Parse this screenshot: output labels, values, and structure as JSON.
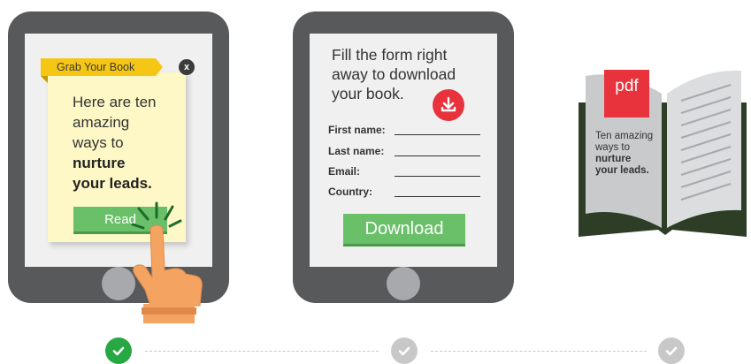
{
  "popup": {
    "banner": "Grab Your Book",
    "close": "x",
    "line1": "Here are ten",
    "line2": "amazing",
    "line3": "ways to",
    "line4": "nurture",
    "line5": "your leads.",
    "button": "Read"
  },
  "form": {
    "title1": "Fill the form right",
    "title2": "away to download",
    "title3": "your book.",
    "fields": [
      "First name:",
      "Last name:",
      "Email:",
      "Country:"
    ],
    "button": "Download"
  },
  "book": {
    "tag": "pdf",
    "line1": "Ten amazing",
    "line2": "ways to",
    "line3": "nurture",
    "line4": "your leads."
  },
  "progress": {
    "steps": [
      "complete",
      "pending",
      "pending"
    ]
  },
  "colors": {
    "tablet": "#58595b",
    "accent_green": "#6abf69",
    "check_green": "#27a843",
    "ribbon_yellow": "#f6c615",
    "note_yellow": "#fdf8c6",
    "download_red": "#e8323c",
    "book_cover": "#2e3e26",
    "step_pending": "#c8c8c8"
  }
}
